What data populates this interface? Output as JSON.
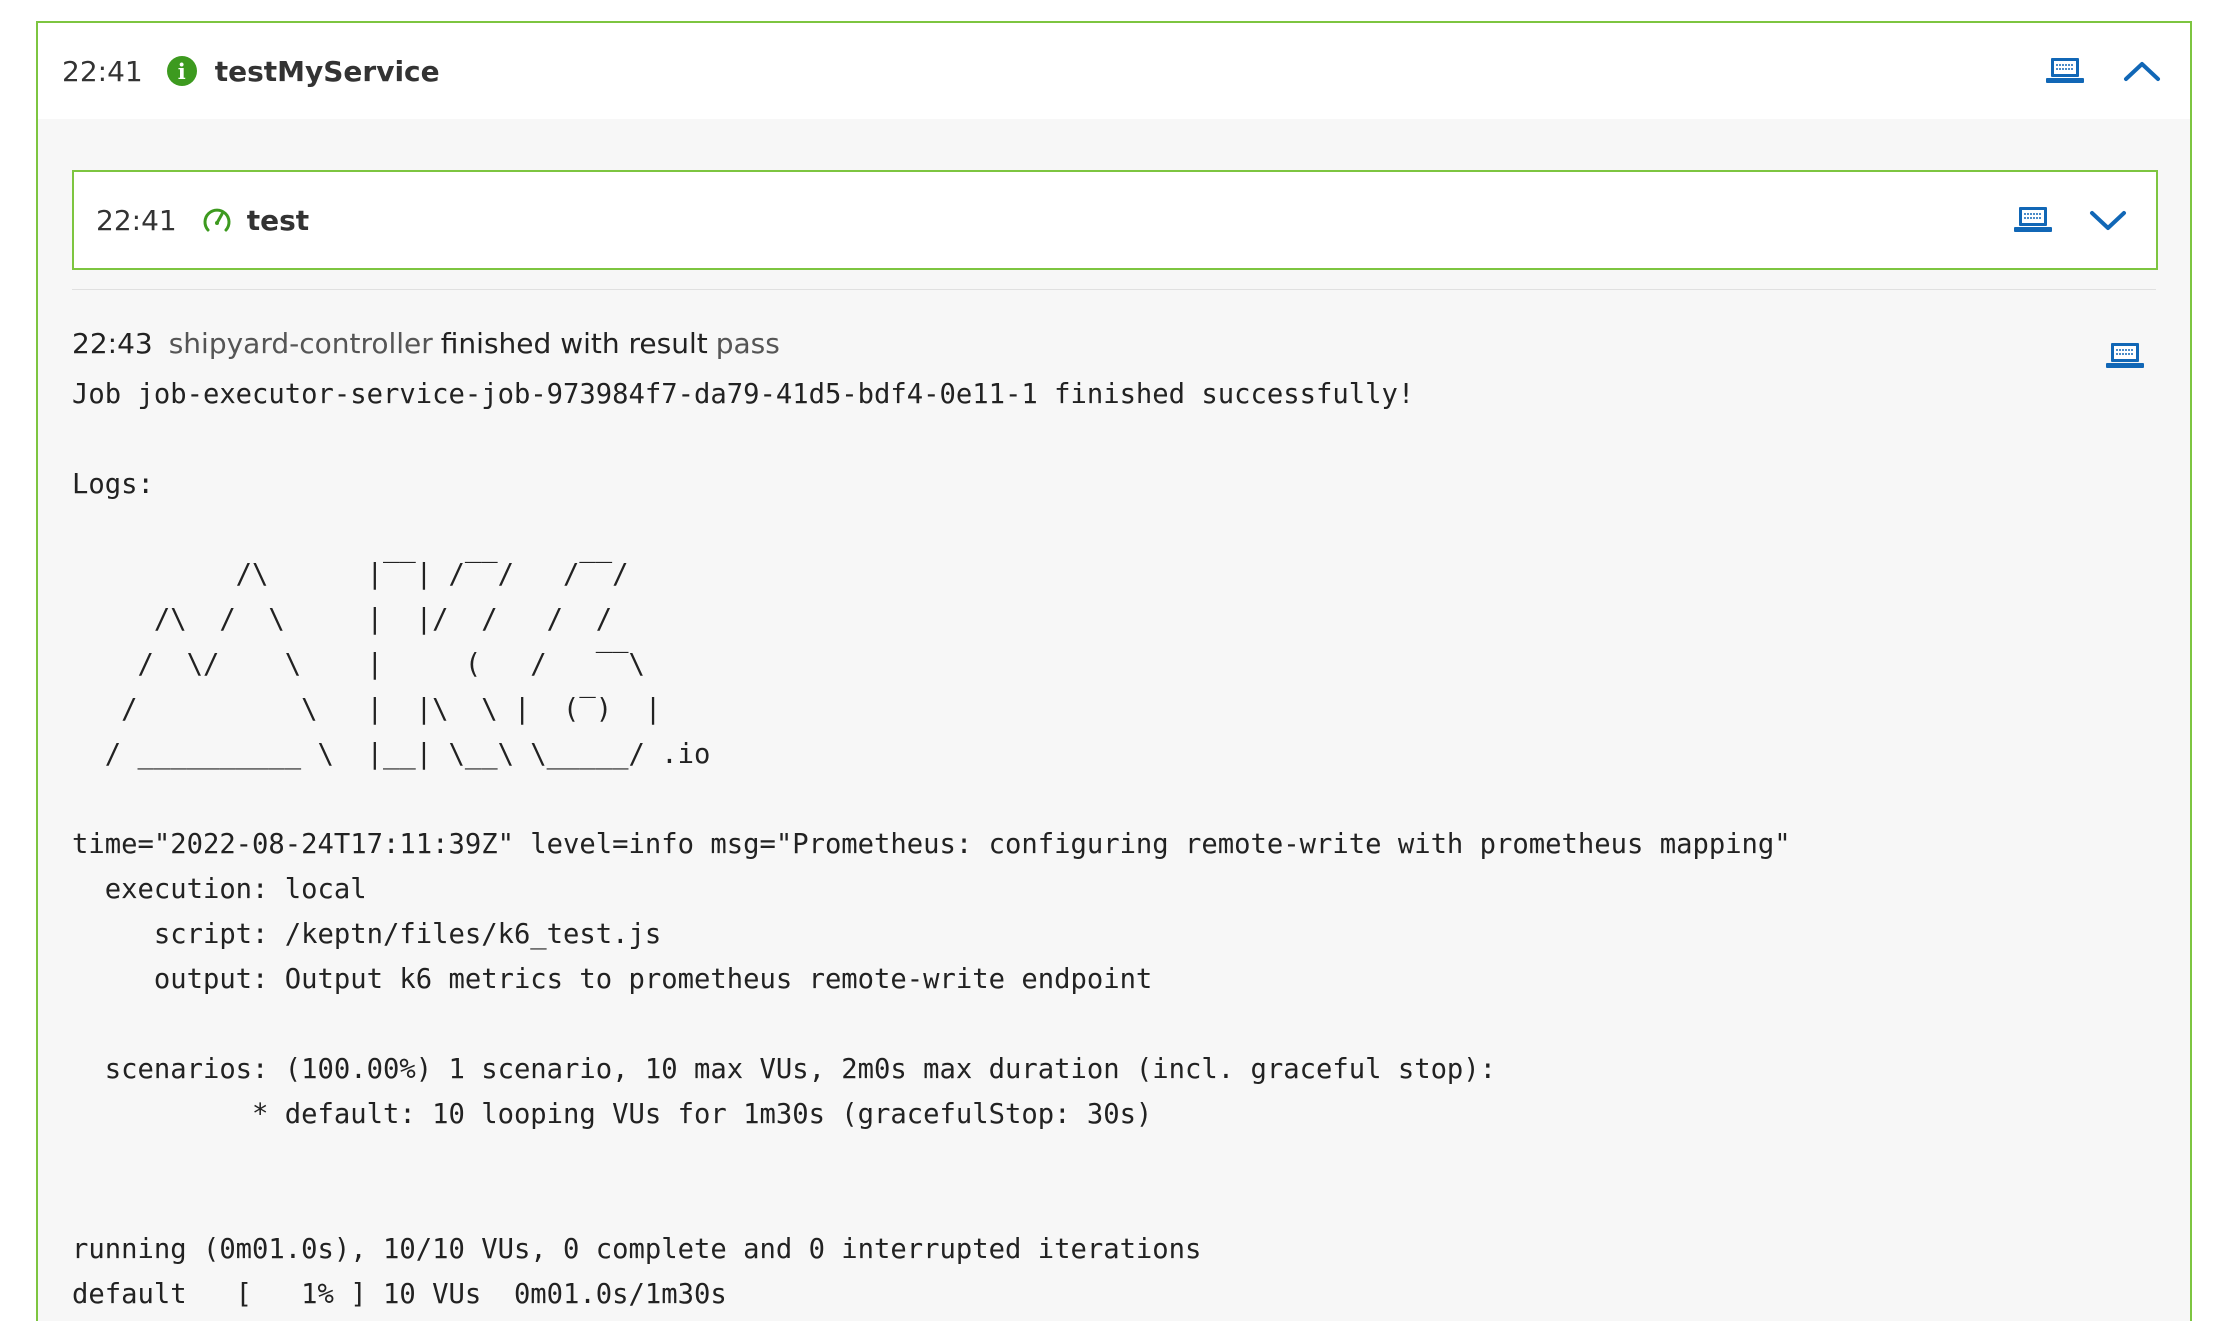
{
  "outer": {
    "time": "22:41",
    "title": "testMyService",
    "info_icon": "info-icon",
    "accent_color": "#7dc540",
    "icon_color": "#1167b6"
  },
  "inner": {
    "time": "22:41",
    "title": "test",
    "status_icon": "gauge-icon"
  },
  "event": {
    "time": "22:43",
    "source": "shipyard-controller",
    "text": "finished with result",
    "result": "pass"
  },
  "log": {
    "text": "Job job-executor-service-job-973984f7-da79-41d5-bdf4-0e11-1 finished successfully!\n\nLogs:\n\n          /\\      |‾‾| /‾‾/   /‾‾/\n     /\\  /  \\     |  |/  /   /  /\n    /  \\/    \\    |     (   /   ‾‾\\\n   /          \\   |  |\\  \\ |  (‾)  |\n  / __________ \\  |__| \\__\\ \\_____/ .io\n\ntime=\"2022-08-24T17:11:39Z\" level=info msg=\"Prometheus: configuring remote-write with prometheus mapping\"\n  execution: local\n     script: /keptn/files/k6_test.js\n     output: Output k6 metrics to prometheus remote-write endpoint\n\n  scenarios: (100.00%) 1 scenario, 10 max VUs, 2m0s max duration (incl. graceful stop):\n           * default: 10 looping VUs for 1m30s (gracefulStop: 30s)\n\n\nrunning (0m01.0s), 10/10 VUs, 0 complete and 0 interrupted iterations\ndefault   [   1% ] 10 VUs  0m01.0s/1m30s"
  }
}
